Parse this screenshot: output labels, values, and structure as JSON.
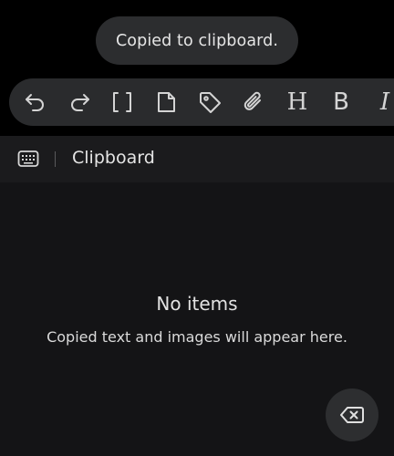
{
  "toast": {
    "message": "Copied to clipboard."
  },
  "toolbar": {
    "items": [
      {
        "name": "undo",
        "icon": "undo-icon"
      },
      {
        "name": "redo",
        "icon": "redo-icon"
      },
      {
        "name": "brackets",
        "icon": "brackets-icon"
      },
      {
        "name": "note",
        "icon": "note-icon"
      },
      {
        "name": "tag",
        "icon": "tag-icon"
      },
      {
        "name": "attach",
        "icon": "paperclip-icon"
      },
      {
        "name": "heading",
        "icon": "heading-icon",
        "glyph": "H"
      },
      {
        "name": "bold",
        "icon": "bold-icon",
        "glyph": "B"
      },
      {
        "name": "italic",
        "icon": "italic-icon",
        "glyph": "I"
      }
    ]
  },
  "clipboard": {
    "title": "Clipboard",
    "keyboard_icon": "keyboard-icon",
    "empty_title": "No items",
    "empty_description": "Copied text and images will appear here.",
    "backspace_icon": "backspace-icon"
  },
  "colors": {
    "background": "#000000",
    "toast_bg": "#2c2d2f",
    "toolbar_bg": "#2a2b2d",
    "panel_bg": "#141416",
    "header_bg": "#1b1b1d",
    "text": "#e4e4e4"
  }
}
